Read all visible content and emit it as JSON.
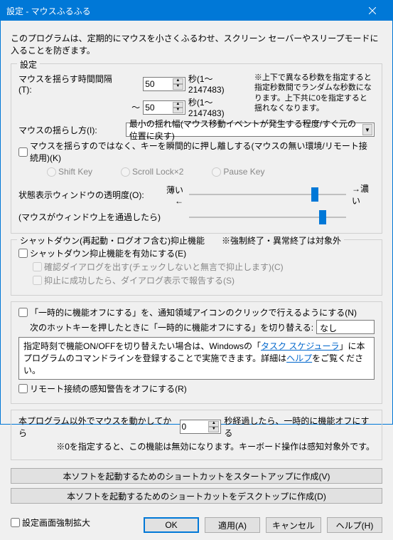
{
  "titlebar": {
    "title": "設定 - マウスふるふる"
  },
  "desc": "このプログラムは、定期的にマウスを小さくふるわせ、スクリーン セーバーやスリープモードに入ることを防ぎます。",
  "settings": {
    "title": "設定",
    "interval_label": "マウスを揺らす時間間隔(T):",
    "interval_from": "50",
    "interval_to": "50",
    "interval_unit1": "秒(1～2147483)",
    "interval_unit2": "秒(1～2147483)",
    "interval_tilde": "～",
    "interval_note": "※上下で異なる秒数を指定すると指定秒数間でランダムな秒数になります。上下共に0を指定すると揺れなくなります。",
    "swing_label": "マウスの揺らし方(I):",
    "swing_value": "最小の揺れ幅(マウス移動イベントが発生する程度/すぐ元の位置に戻す)",
    "press_key_label": "マウスを揺らすのではなく、キーを瞬間的に押し離しする(マウスの無い環境/リモート接続用)(K)",
    "radio_shift": "Shift Key",
    "radio_scroll": "Scroll Lock×2",
    "radio_pause": "Pause Key",
    "opacity_label": "状態表示ウィンドウの透明度(O):",
    "opacity_hover_label": "(マウスがウィンドウ上を通過したら)",
    "thin": "薄い←",
    "thick": "→濃い"
  },
  "shutdown": {
    "title": "シャットダウン(再起動・ログオフ含む)抑止機能　　※強制終了・異常終了は対象外",
    "enable_label": "シャットダウン抑止機能を有効にする(E)",
    "confirm_label": "確認ダイアログを出す(チェックしないと無言で抑止します)(C)",
    "report_label": "抑止に成功したら、ダイアログ表示で報告する(S)"
  },
  "tray": {
    "toggle_label": "「一時的に機能オフにする」を、通知領域アイコンのクリックで行えるようにする(N)",
    "hotkey_label": "次のホットキーを押したときに「一時的に機能オフにする」を切り替える:",
    "hotkey_value": "なし",
    "info_pre": "指定時刻で機能ON/OFFを切り替えたい場合は、Windowsの「",
    "info_link1": "タスク スケジューラ",
    "info_mid": "」に本プログラムのコマンドラインを登録することで実施できます。詳細は",
    "info_link2": "ヘルプ",
    "info_post": "をご覧ください。",
    "remote_label": "リモート接続の感知警告をオフにする(R)"
  },
  "idle": {
    "prefix": "本プログラム以外でマウスを動かしてから",
    "value": "0",
    "suffix": "秒経過したら、一時的に機能オフにする",
    "note": "※0を指定すると、この機能は無効になります。キーボード操作は感知対象外です。"
  },
  "buttons": {
    "startup": "本ソフトを起動するためのショートカットをスタートアップに作成(V)",
    "desktop": "本ソフトを起動するためのショートカットをデスクトップに作成(D)",
    "force_expand": "設定画面強制拡大",
    "ok": "OK",
    "apply": "適用(A)",
    "cancel": "キャンセル",
    "help": "ヘルプ(H)"
  }
}
